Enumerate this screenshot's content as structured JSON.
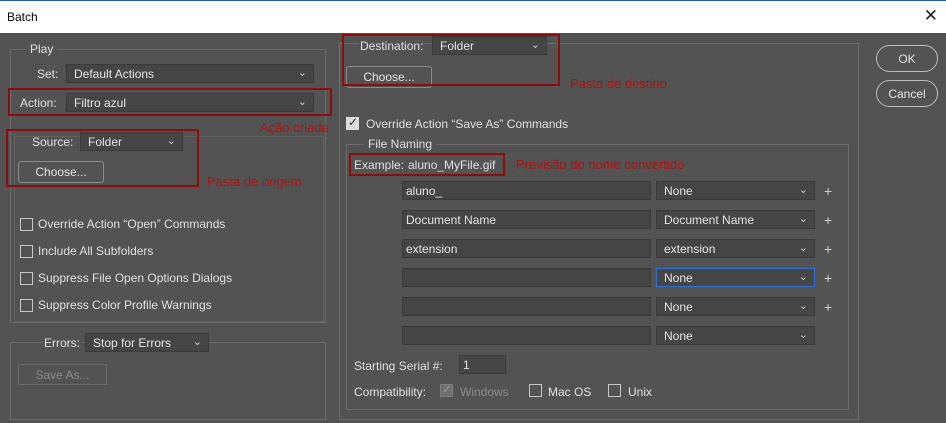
{
  "window": {
    "title": "Batch",
    "close_glyph": "✕"
  },
  "buttons": {
    "ok": "OK",
    "cancel": "Cancel"
  },
  "play": {
    "legend": "Play",
    "set_label": "Set:",
    "set_value": "Default Actions",
    "action_label": "Action:",
    "action_value": "Filtro azul",
    "source_label": "Source:",
    "source_value": "Folder",
    "choose": "Choose...",
    "options": [
      "Override Action “Open” Commands",
      "Include All Subfolders",
      "Suppress File Open Options Dialogs",
      "Suppress Color Profile Warnings"
    ]
  },
  "errors": {
    "label": "Errors:",
    "value": "Stop for Errors",
    "save_as": "Save As..."
  },
  "destination": {
    "label": "Destination:",
    "value": "Folder",
    "choose": "Choose...",
    "override_save_as": "Override Action “Save As” Commands",
    "override_checked": true
  },
  "file_naming": {
    "legend": "File Naming",
    "example_label": "Example:",
    "example_value": "aluno_MyFile.gif",
    "rows": [
      {
        "text": "aluno_",
        "option": "None"
      },
      {
        "text": "Document Name",
        "option": "Document Name"
      },
      {
        "text": "extension",
        "option": "extension"
      },
      {
        "text": "",
        "option": "None"
      },
      {
        "text": "",
        "option": "None"
      },
      {
        "text": "",
        "option": "None"
      }
    ],
    "plus": "+",
    "serial_label": "Starting Serial #:",
    "serial_value": "1",
    "compat_label": "Compatibility:",
    "compat": {
      "windows": "Windows",
      "macos": "Mac OS",
      "unix": "Unix"
    }
  },
  "annotations": {
    "acao_criada": "Ação criada",
    "pasta_origem": "Pasta de origem",
    "pasta_destino": "Pasta de destino",
    "previsao": "Previsão do nome convertido"
  },
  "colors": {
    "background": "#535353",
    "annotation_red": "#b01010",
    "focus_blue": "#2f6fd6"
  },
  "icons": {
    "dropdown": "chevron-down-icon",
    "checkbox": "checkmark-icon",
    "add": "plus-icon"
  }
}
